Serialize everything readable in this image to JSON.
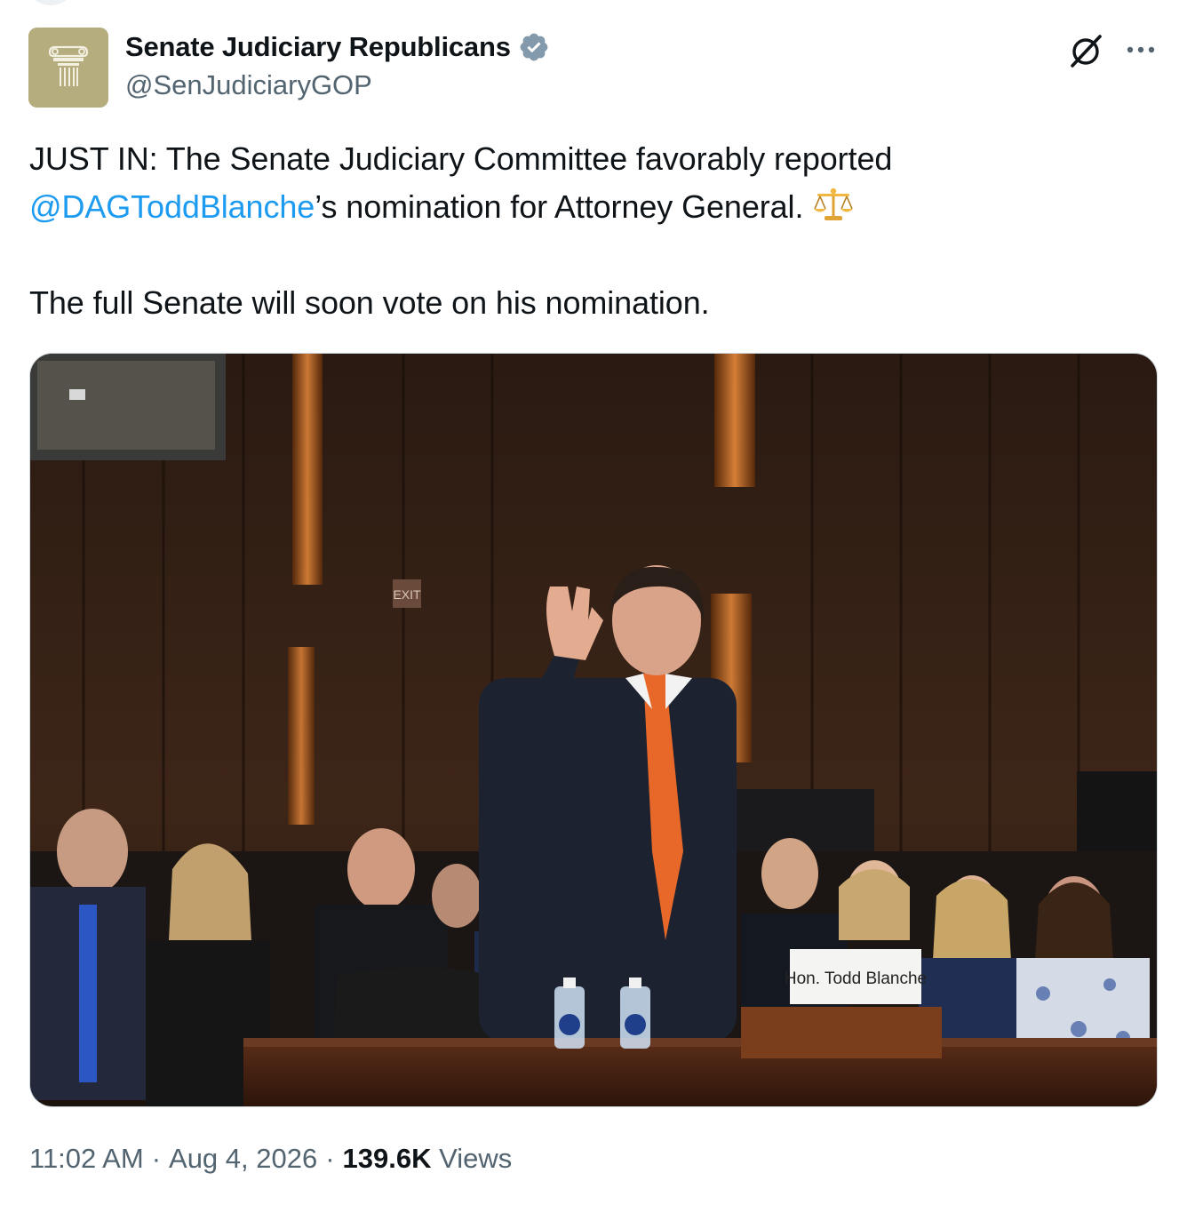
{
  "author": {
    "display_name": "Senate Judiciary Republicans",
    "handle": "@SenJudiciaryGOP",
    "verified": true,
    "avatar_color": "#b5ad7e",
    "avatar_icon": "capitol-column-icon"
  },
  "actions": {
    "grok_icon": "grok-icon",
    "more_icon": "more-dots-icon"
  },
  "tweet": {
    "line1": "JUST IN: The Senate Judiciary Committee favorably reported",
    "mention": "@DAGToddBlanche",
    "line2_rest": "’s nomination for Attorney General.",
    "emoji": "scales-icon",
    "line3": "The full Senate will soon vote on his nomination."
  },
  "media": {
    "nameplate": "Hon. Todd Blanche",
    "exit_sign": "EXIT"
  },
  "meta": {
    "time": "11:02 AM",
    "date": "Aug 4, 2026",
    "separator": "·",
    "views_count": "139.6K",
    "views_label": "Views"
  },
  "colors": {
    "text": "#0f1419",
    "secondary": "#536471",
    "link": "#1d9bf0",
    "verified": "#829aab"
  }
}
